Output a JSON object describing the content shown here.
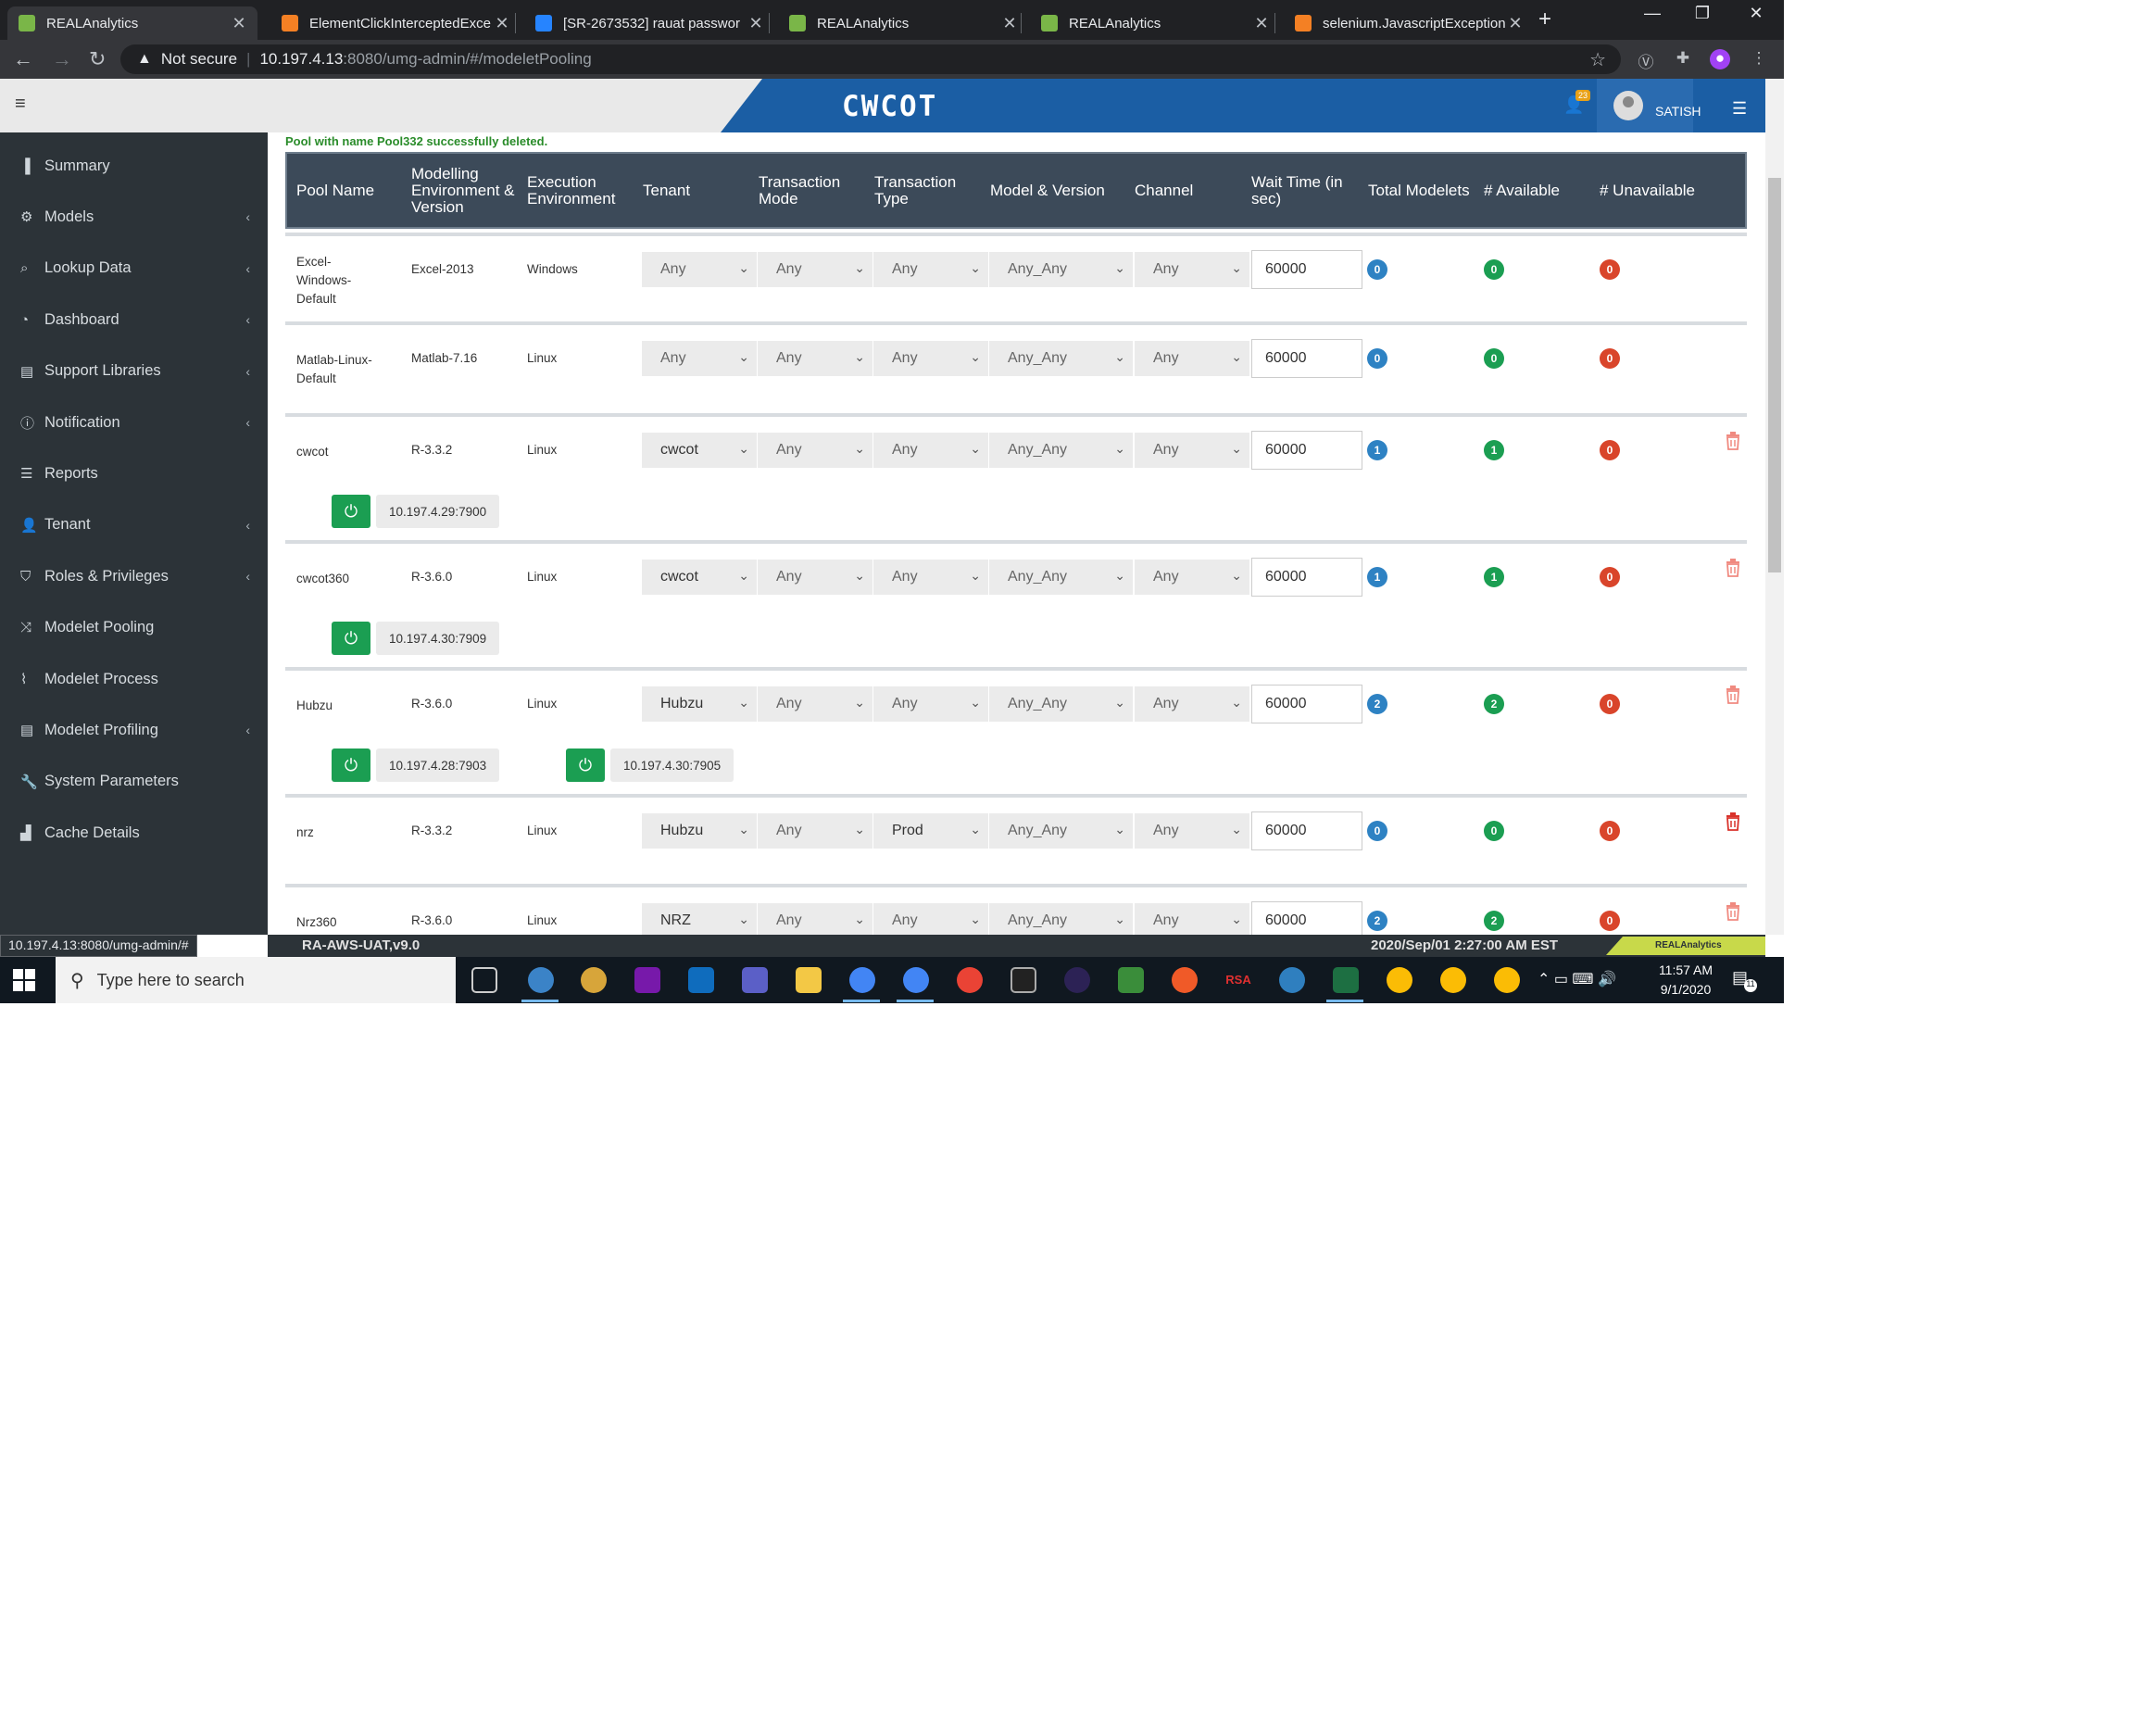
{
  "browser": {
    "tabs": [
      {
        "title": "REALAnalytics",
        "active": true,
        "favicon_color": "#7ab648"
      },
      {
        "title": "ElementClickInterceptedExce",
        "active": false,
        "favicon_color": "#f48024"
      },
      {
        "title": "[SR-2673532] rauat passwor",
        "active": false,
        "favicon_color": "#2684ff"
      },
      {
        "title": "REALAnalytics",
        "active": false,
        "favicon_color": "#7ab648"
      },
      {
        "title": "REALAnalytics",
        "active": false,
        "favicon_color": "#7ab648"
      },
      {
        "title": "selenium.JavascriptException",
        "active": false,
        "favicon_color": "#f48024"
      }
    ],
    "address": {
      "security": "Not secure",
      "host": "10.197.4.13",
      "path": ":8080/umg-admin/#/modeletPooling"
    },
    "status_url": "10.197.4.13:8080/umg-admin/#"
  },
  "header": {
    "brand": "CWCOT",
    "notification_count": "23",
    "username": "SATISH"
  },
  "sidebar": {
    "items": [
      {
        "label": "Summary",
        "icon": "bar-chart-icon",
        "glyph": "▐",
        "has_submenu": false
      },
      {
        "label": "Models",
        "icon": "gear-icon",
        "glyph": "⚙",
        "has_submenu": true
      },
      {
        "label": "Lookup Data",
        "icon": "search-icon",
        "glyph": "⌕",
        "has_submenu": true
      },
      {
        "label": "Dashboard",
        "icon": "dashboard-icon",
        "glyph": "◔",
        "has_submenu": true
      },
      {
        "label": "Support Libraries",
        "icon": "book-icon",
        "glyph": "▤",
        "has_submenu": true
      },
      {
        "label": "Notification",
        "icon": "info-icon",
        "glyph": "ⓘ",
        "has_submenu": true
      },
      {
        "label": "Reports",
        "icon": "list-icon",
        "glyph": "☰",
        "has_submenu": false
      },
      {
        "label": "Tenant",
        "icon": "user-icon",
        "glyph": "👤",
        "has_submenu": true
      },
      {
        "label": "Roles & Privileges",
        "icon": "shield-icon",
        "glyph": "⛉",
        "has_submenu": true
      },
      {
        "label": "Modelet Pooling",
        "icon": "shuffle-icon",
        "glyph": "⤨",
        "has_submenu": false
      },
      {
        "label": "Modelet Process",
        "icon": "paperclip-icon",
        "glyph": "⌇",
        "has_submenu": false
      },
      {
        "label": "Modelet Profiling",
        "icon": "book-icon",
        "glyph": "▤",
        "has_submenu": true
      },
      {
        "label": "System Parameters",
        "icon": "wrench-icon",
        "glyph": "🔧",
        "has_submenu": false
      },
      {
        "label": "Cache Details",
        "icon": "signal-icon",
        "glyph": "▟",
        "has_submenu": false
      }
    ]
  },
  "main": {
    "success_message": "Pool with name Pool332 successfully deleted.",
    "columns": {
      "pool_name": "Pool Name",
      "modelling_env": "Modelling Environment & Version",
      "execution_env": "Execution Environment",
      "tenant": "Tenant",
      "transaction_mode": "Transaction Mode",
      "transaction_type": "Transaction Type",
      "model_version": "Model & Version",
      "channel": "Channel",
      "wait_time": "Wait Time (in sec)",
      "total_modelets": "Total Modelets",
      "available": "# Available",
      "unavailable": "# Unavailable"
    },
    "rows": [
      {
        "pool_name": "Excel-Windows-Default",
        "modelling_env": "Excel-2013",
        "execution_env": "Windows",
        "tenant": "Any",
        "transaction_mode": "Any",
        "transaction_type": "Any",
        "model_version": "Any_Any",
        "channel": "Any",
        "wait_time": "60000",
        "total": "0",
        "available": "0",
        "unavailable": "0",
        "deletable": false,
        "modelets": []
      },
      {
        "pool_name": "Matlab-Linux-Default",
        "modelling_env": "Matlab-7.16",
        "execution_env": "Linux",
        "tenant": "Any",
        "transaction_mode": "Any",
        "transaction_type": "Any",
        "model_version": "Any_Any",
        "channel": "Any",
        "wait_time": "60000",
        "total": "0",
        "available": "0",
        "unavailable": "0",
        "deletable": false,
        "modelets": []
      },
      {
        "pool_name": "cwcot",
        "modelling_env": "R-3.3.2",
        "execution_env": "Linux",
        "tenant": "cwcot",
        "transaction_mode": "Any",
        "transaction_type": "Any",
        "model_version": "Any_Any",
        "channel": "Any",
        "wait_time": "60000",
        "total": "1",
        "available": "1",
        "unavailable": "0",
        "deletable": true,
        "modelets": [
          "10.197.4.29:7900"
        ]
      },
      {
        "pool_name": "cwcot360",
        "modelling_env": "R-3.6.0",
        "execution_env": "Linux",
        "tenant": "cwcot",
        "transaction_mode": "Any",
        "transaction_type": "Any",
        "model_version": "Any_Any",
        "channel": "Any",
        "wait_time": "60000",
        "total": "1",
        "available": "1",
        "unavailable": "0",
        "deletable": true,
        "modelets": [
          "10.197.4.30:7909"
        ]
      },
      {
        "pool_name": "Hubzu",
        "modelling_env": "R-3.6.0",
        "execution_env": "Linux",
        "tenant": "Hubzu",
        "transaction_mode": "Any",
        "transaction_type": "Any",
        "model_version": "Any_Any",
        "channel": "Any",
        "wait_time": "60000",
        "total": "2",
        "available": "2",
        "unavailable": "0",
        "deletable": true,
        "modelets": [
          "10.197.4.28:7903",
          "10.197.4.30:7905"
        ]
      },
      {
        "pool_name": "nrz",
        "modelling_env": "R-3.3.2",
        "execution_env": "Linux",
        "tenant": "Hubzu",
        "transaction_mode": "Any",
        "transaction_type": "Prod",
        "model_version": "Any_Any",
        "channel": "Any",
        "wait_time": "60000",
        "total": "0",
        "available": "0",
        "unavailable": "0",
        "deletable": true,
        "modelets": []
      },
      {
        "pool_name": "Nrz360",
        "modelling_env": "R-3.6.0",
        "execution_env": "Linux",
        "tenant": "NRZ",
        "transaction_mode": "Any",
        "transaction_type": "Any",
        "model_version": "Any_Any",
        "channel": "Any",
        "wait_time": "60000",
        "total": "2",
        "available": "2",
        "unavailable": "0",
        "deletable": true,
        "modelets": []
      }
    ]
  },
  "footer": {
    "version": "RA-AWS-UAT,v9.0",
    "datetime": "2020/Sep/01 2:27:00 AM EST",
    "logo_text": "REALAnalytics"
  },
  "taskbar": {
    "search_placeholder": "Type here to search",
    "time": "11:57 AM",
    "date": "9/1/2020",
    "notification_count": "11"
  },
  "colors": {
    "brand_blue": "#1b5ea4",
    "sidebar_bg": "#2c3338",
    "table_header_bg": "#3c4a59",
    "badge_blue": "#2e82c3",
    "badge_green": "#1b9e52",
    "badge_red": "#d9452b",
    "success_text": "#2a8c2a"
  }
}
